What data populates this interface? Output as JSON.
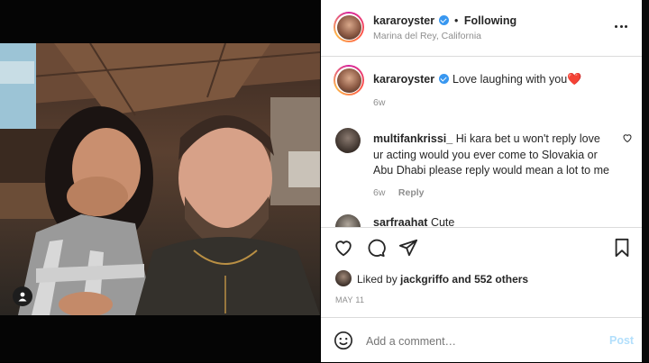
{
  "post": {
    "author": "kararoyster",
    "location": "Marina del Rey, California",
    "follow_status": "Following",
    "caption_text": "Love laughing with you",
    "caption_emoji": "❤️",
    "caption_age": "6w",
    "likes_prefix": "Liked by",
    "liked_by": "jackgriffo",
    "likes_suffix": "and 552 others",
    "date": "MAY 11"
  },
  "comments": [
    {
      "user": "multifankrissi_",
      "text": "Hi kara bet u won't reply love ur acting would you ever come to Slovakia or Abu Dhabi please reply would mean a lot to me",
      "age": "6w",
      "reply_label": "Reply"
    },
    {
      "user": "sarfraahat",
      "text": "Cute"
    }
  ],
  "add_comment": {
    "placeholder": "Add a comment…",
    "post_label": "Post"
  },
  "icons": {
    "more": "more-options-icon",
    "like": "heart-icon",
    "comment": "comment-icon",
    "share": "share-icon",
    "save": "bookmark-icon",
    "emoji": "emoji-icon",
    "tag": "user-tag-icon"
  },
  "colors": {
    "verified": "#3897f0",
    "muted": "#8e8e8e",
    "post_link": "#b2dffc",
    "heart": "#ed4956"
  }
}
